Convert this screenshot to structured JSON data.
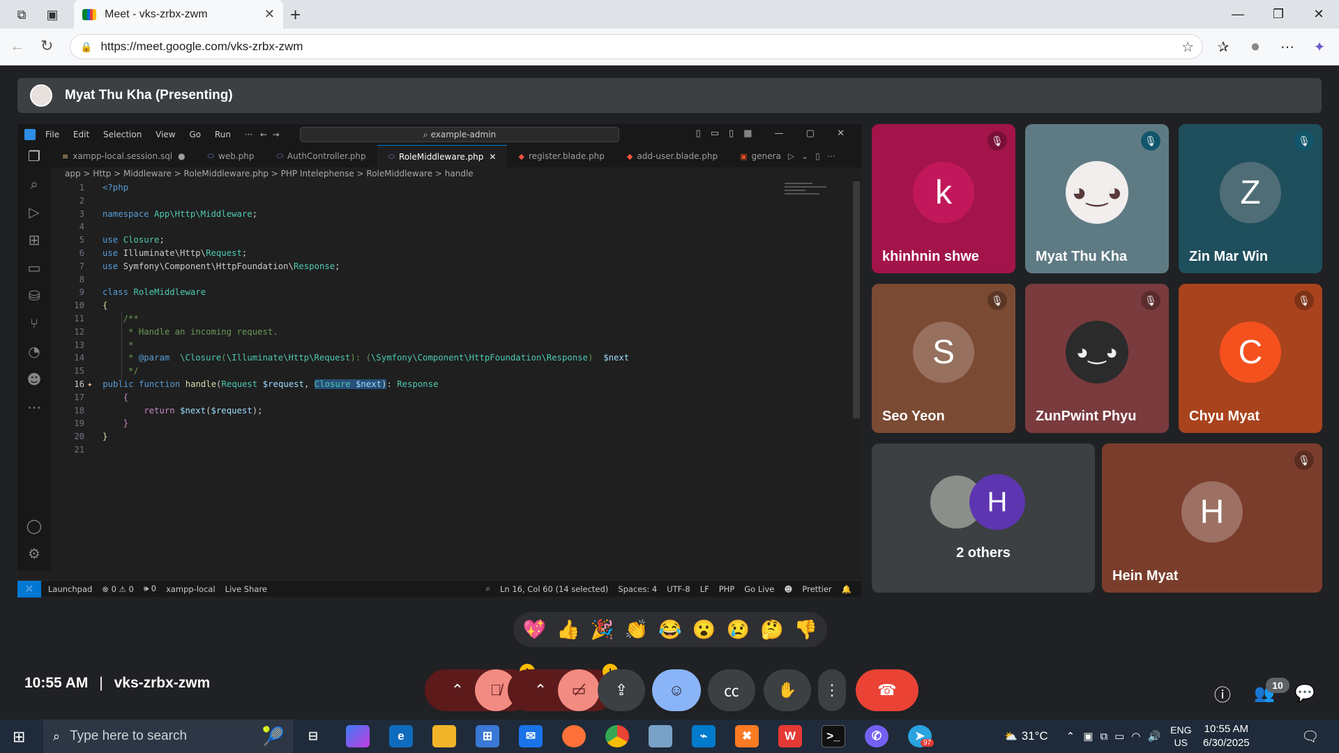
{
  "browser": {
    "tab_title": "Meet - vks-zrbx-zwm",
    "url": "https://meet.google.com/vks-zrbx-zwm"
  },
  "meet": {
    "presenter_label": "Myat Thu Kha (Presenting)",
    "time": "10:55 AM",
    "separator": "|",
    "meeting_code": "vks-zrbx-zwm",
    "people_count": "10",
    "participants": [
      {
        "name": "khinhnin shwe",
        "initial": "k",
        "bg": "#a3144a",
        "avatar": "#c2185b"
      },
      {
        "name": "Myat Thu Kha",
        "initial": "",
        "bg": "#5e7b84",
        "avatar": "#eee"
      },
      {
        "name": "Zin Mar Win",
        "initial": "Z",
        "bg": "#1f4f5c",
        "avatar": "#4f6d76"
      },
      {
        "name": "Seo Yeon",
        "initial": "S",
        "bg": "#7b4a33",
        "avatar": "#97705e"
      },
      {
        "name": "ZunPwint Phyu",
        "initial": "",
        "bg": "#7a3b3e",
        "avatar": "#333"
      },
      {
        "name": "Chyu Myat",
        "initial": "C",
        "bg": "#a8431d",
        "avatar": "#f4511e"
      },
      {
        "name": "Hein Myat",
        "initial": "H",
        "bg": "#7a3d2c",
        "avatar": "#9c7063"
      }
    ],
    "others": {
      "label": "2 others",
      "initial": "H"
    },
    "reactions": [
      "💖",
      "👍",
      "🎉",
      "👏",
      "😂",
      "😮",
      "😢",
      "🤔",
      "👎"
    ]
  },
  "vscode": {
    "menu": [
      "File",
      "Edit",
      "Selection",
      "View",
      "Go",
      "Run",
      "···"
    ],
    "search": "example-admin",
    "tabs": [
      {
        "label": "xampp-local.session.sql",
        "icon": "≡",
        "color": "#e8c07d",
        "dot": "●"
      },
      {
        "label": "web.php",
        "icon": "🐘",
        "color": "#7a86d4"
      },
      {
        "label": "AuthController.php",
        "icon": "🐘",
        "color": "#7a86d4"
      },
      {
        "label": "RoleMiddleware.php",
        "icon": "🐘",
        "color": "#7a86d4",
        "close": "✕"
      },
      {
        "label": "register.blade.php",
        "icon": "◆",
        "color": "#f05340"
      },
      {
        "label": "add-user.blade.php",
        "icon": "◆",
        "color": "#f05340"
      },
      {
        "label": "genera",
        "icon": "5",
        "color": "#e44d26"
      }
    ],
    "breadcrumb": "app > Http > Middleware > RoleMiddleware.php > PHP Intelephense > RoleMiddleware > handle",
    "line_numbers": [
      "1",
      "2",
      "3",
      "4",
      "5",
      "6",
      "7",
      "8",
      "9",
      "10",
      "11",
      "12",
      "13",
      "14",
      "15",
      "16",
      "17",
      "18",
      "19",
      "20",
      "21"
    ],
    "status": {
      "launchpad": "Launchpad",
      "problems": "⊗ 0 ⚠ 0",
      "ports": "🕪 0",
      "db": "xampp-local",
      "liveshare": "Live Share",
      "position": "Ln 16, Col 60 (14 selected)",
      "spaces": "Spaces: 4",
      "encoding": "UTF-8",
      "eol": "LF",
      "lang": "PHP",
      "golive": "Go Live",
      "prettier": "Prettier"
    }
  },
  "taskbar": {
    "search_placeholder": "Type here to search",
    "weather": "31°C",
    "lang": "ENG",
    "region": "US",
    "time": "10:55 AM",
    "date": "6/30/2025",
    "telegram_badge": "97"
  }
}
